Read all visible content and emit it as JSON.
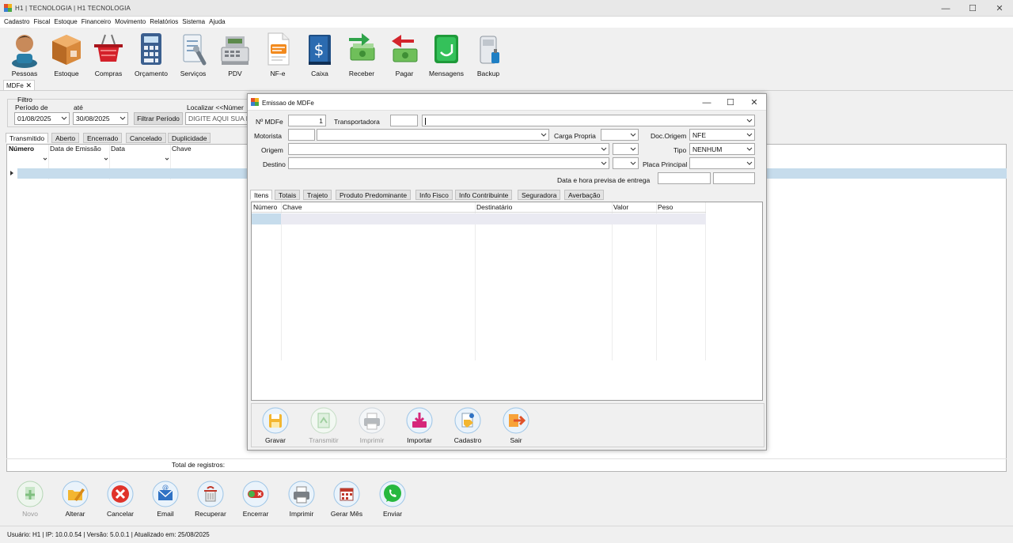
{
  "window": {
    "title": "H1  |  TECNOLOGIA  |  H1 TECNOLOGIA",
    "minimize": "—",
    "maximize": "☐",
    "close": "✕"
  },
  "menu": [
    "Cadastro",
    "Fiscal",
    "Estoque",
    "Financeiro",
    "Movimento",
    "Relatórios",
    "Sistema",
    "Ajuda"
  ],
  "toolbar": [
    {
      "label": "Pessoas",
      "icon": "person-icon"
    },
    {
      "label": "Estoque",
      "icon": "box-icon"
    },
    {
      "label": "Compras",
      "icon": "basket-icon"
    },
    {
      "label": "Orçamento",
      "icon": "calculator-icon"
    },
    {
      "label": "Serviços",
      "icon": "tools-icon"
    },
    {
      "label": "PDV",
      "icon": "cash-register-icon"
    },
    {
      "label": "NF-e",
      "icon": "nfe-document-icon"
    },
    {
      "label": "Caixa",
      "icon": "cash-book-icon"
    },
    {
      "label": "Receber",
      "icon": "money-in-icon"
    },
    {
      "label": "Pagar",
      "icon": "money-out-icon"
    },
    {
      "label": "Mensagens",
      "icon": "message-icon"
    },
    {
      "label": "Backup",
      "icon": "backup-drive-icon"
    }
  ],
  "doc_tab": {
    "label": "MDFe",
    "close": "✕"
  },
  "filter": {
    "group_label": "Filtro",
    "period_label": "Período de",
    "until_label": "até",
    "date_from": "01/08/2025",
    "date_to": "30/08/2025",
    "filter_button": "Filtrar Período",
    "search_label": "Localizar <<Númer",
    "search_placeholder": "DIGITE AQUI SUA P"
  },
  "status_tabs": [
    "Transmitido",
    "Aberto",
    "Encerrado",
    "Cancelado",
    "Duplicidade"
  ],
  "main_grid": {
    "columns": [
      "Número",
      "Data de Emissão",
      "Data",
      "Chave"
    ],
    "total_label": "Total de registros:"
  },
  "bottom_buttons": [
    {
      "label": "Novo",
      "icon": "add-doc-icon",
      "enabled": false
    },
    {
      "label": "Alterar",
      "icon": "edit-folder-icon",
      "enabled": true
    },
    {
      "label": "Cancelar",
      "icon": "cancel-icon",
      "enabled": true
    },
    {
      "label": "Email",
      "icon": "email-icon",
      "enabled": true
    },
    {
      "label": "Recuperar",
      "icon": "recover-icon",
      "enabled": true
    },
    {
      "label": "Encerrar",
      "icon": "close-toggle-icon",
      "enabled": true
    },
    {
      "label": "Imprimir",
      "icon": "printer-icon",
      "enabled": true
    },
    {
      "label": "Gerar Mês",
      "icon": "calendar-icon",
      "enabled": true
    },
    {
      "label": "Enviar",
      "icon": "whatsapp-icon",
      "enabled": true
    }
  ],
  "status_bar": "Usuário: H1 | IP: 10.0.0.54 | Versão: 5.0.0.1 | Atualizado em: 25/08/2025",
  "dialog": {
    "title": "Emissao de MDFe",
    "fields": {
      "nro_label": "Nº MDFe",
      "nro_value": "1",
      "transportadora_label": "Transportadora",
      "motorista_label": "Motorista",
      "carga_label": "Carga Propria",
      "doc_origem_label": "Doc.Origem",
      "doc_origem_value": "NFE",
      "origem_label": "Origem",
      "tipo_label": "Tipo",
      "tipo_value": "NENHUM",
      "destino_label": "Destino",
      "placa_label": "Placa Principal",
      "data_entrega_label": "Data e hora previsa de entrega"
    },
    "tabs": [
      "Itens",
      "Totais",
      "Trajeto",
      "Produto Predominante",
      "Info Fisco",
      "Info Contribuinte",
      "Seguradora",
      "Averbação"
    ],
    "grid_columns": [
      "Número",
      "Chave",
      "Destinatário",
      "Valor",
      "Peso"
    ],
    "buttons": [
      {
        "label": "Gravar",
        "icon": "save-icon",
        "enabled": true
      },
      {
        "label": "Transmitir",
        "icon": "transmit-icon",
        "enabled": false
      },
      {
        "label": "Imprimir",
        "icon": "printer-icon",
        "enabled": false
      },
      {
        "label": "Importar",
        "icon": "import-icon",
        "enabled": true
      },
      {
        "label": "Cadastro",
        "icon": "register-icon",
        "enabled": true
      },
      {
        "label": "Sair",
        "icon": "exit-icon",
        "enabled": true
      }
    ]
  },
  "colors": {
    "row_highlight": "#c6dcec",
    "accent_blue": "#2f72c4"
  }
}
